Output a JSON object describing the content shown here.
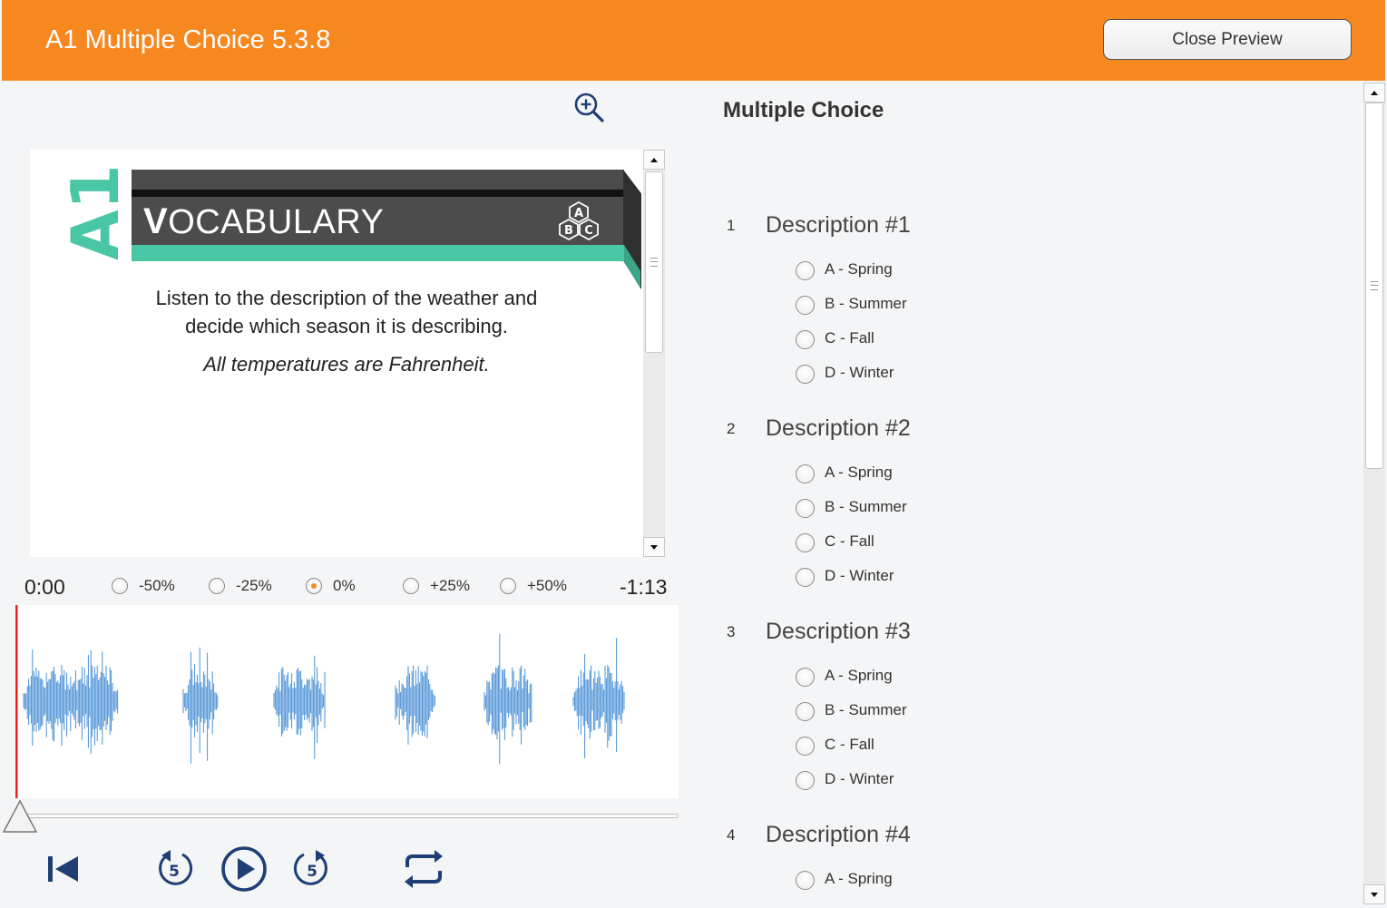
{
  "header": {
    "title": "A1 Multiple Choice 5.3.8",
    "close_label": "Close Preview",
    "color": "#f7881f"
  },
  "document": {
    "badge": "A1",
    "banner_title_first": "V",
    "banner_title_rest": "OCABULARY",
    "banner_icon_letters": [
      "A",
      "B",
      "C"
    ],
    "instruction_line1": "Listen to the description of the weather and",
    "instruction_line2": "decide which season it is describing.",
    "instruction_note": "All temperatures are Fahrenheit.",
    "accent": "#49c7a5"
  },
  "player": {
    "elapsed": "0:00",
    "remaining": "-1:13",
    "speeds": [
      {
        "label": "-50%",
        "selected": false
      },
      {
        "label": "-25%",
        "selected": false
      },
      {
        "label": "0%",
        "selected": true
      },
      {
        "label": "+25%",
        "selected": false
      },
      {
        "label": "+50%",
        "selected": false
      }
    ],
    "progress": 0,
    "controls": [
      "skip-to-start-icon",
      "rewind-5-icon",
      "play-icon",
      "forward-5-icon",
      "repeat-icon"
    ],
    "rewind_seconds": "5",
    "forward_seconds": "5",
    "wave_color": "#4b91d6",
    "playhead_color": "#e3201b"
  },
  "questions": {
    "title": "Multiple Choice",
    "items": [
      {
        "number": "1",
        "description": "Description #1",
        "options": [
          "A - Spring",
          "B - Summer",
          "C - Fall",
          "D - Winter"
        ]
      },
      {
        "number": "2",
        "description": "Description #2",
        "options": [
          "A - Spring",
          "B - Summer",
          "C - Fall",
          "D - Winter"
        ]
      },
      {
        "number": "3",
        "description": "Description #3",
        "options": [
          "A - Spring",
          "B - Summer",
          "C - Fall",
          "D - Winter"
        ]
      },
      {
        "number": "4",
        "description": "Description #4",
        "options": [
          "A - Spring"
        ]
      }
    ]
  }
}
